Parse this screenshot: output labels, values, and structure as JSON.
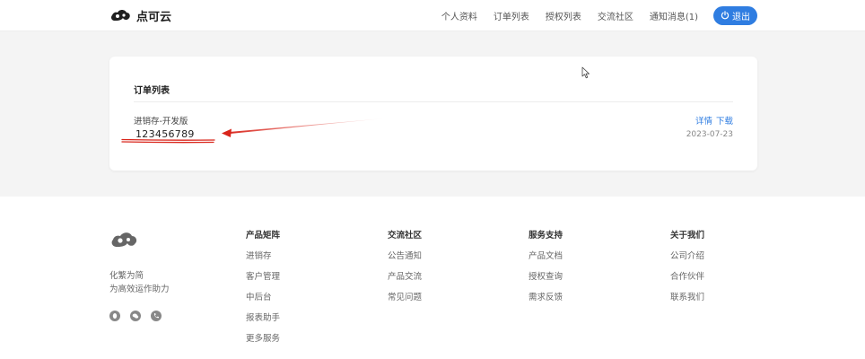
{
  "header": {
    "brand": "点可云",
    "nav": [
      "个人资料",
      "订单列表",
      "授权列表",
      "交流社区",
      "通知消息(1)"
    ],
    "logout_label": "退出"
  },
  "card": {
    "title": "订单列表",
    "order": {
      "product": "进销存-开发版",
      "number": "123456789",
      "links": [
        "详情",
        "下载"
      ],
      "date": "2023-07-23"
    }
  },
  "footer": {
    "slogan_line1": "化繁为简",
    "slogan_line2": "为高效运作助力",
    "social_icons": [
      "qq-icon",
      "wechat-icon",
      "phone-icon"
    ],
    "columns": [
      {
        "title": "产品矩阵",
        "items": [
          "进销存",
          "客户管理",
          "中后台",
          "报表助手",
          "更多服务"
        ]
      },
      {
        "title": "交流社区",
        "items": [
          "公告通知",
          "产品交流",
          "常见问题"
        ]
      },
      {
        "title": "服务支持",
        "items": [
          "产品文档",
          "授权查询",
          "需求反馈"
        ]
      },
      {
        "title": "关于我们",
        "items": [
          "公司介绍",
          "合作伙伴",
          "联系我们"
        ]
      }
    ]
  },
  "colors": {
    "accent": "#2f7de1",
    "annotation": "#d9261c",
    "page_bg": "#f4f4f4"
  }
}
